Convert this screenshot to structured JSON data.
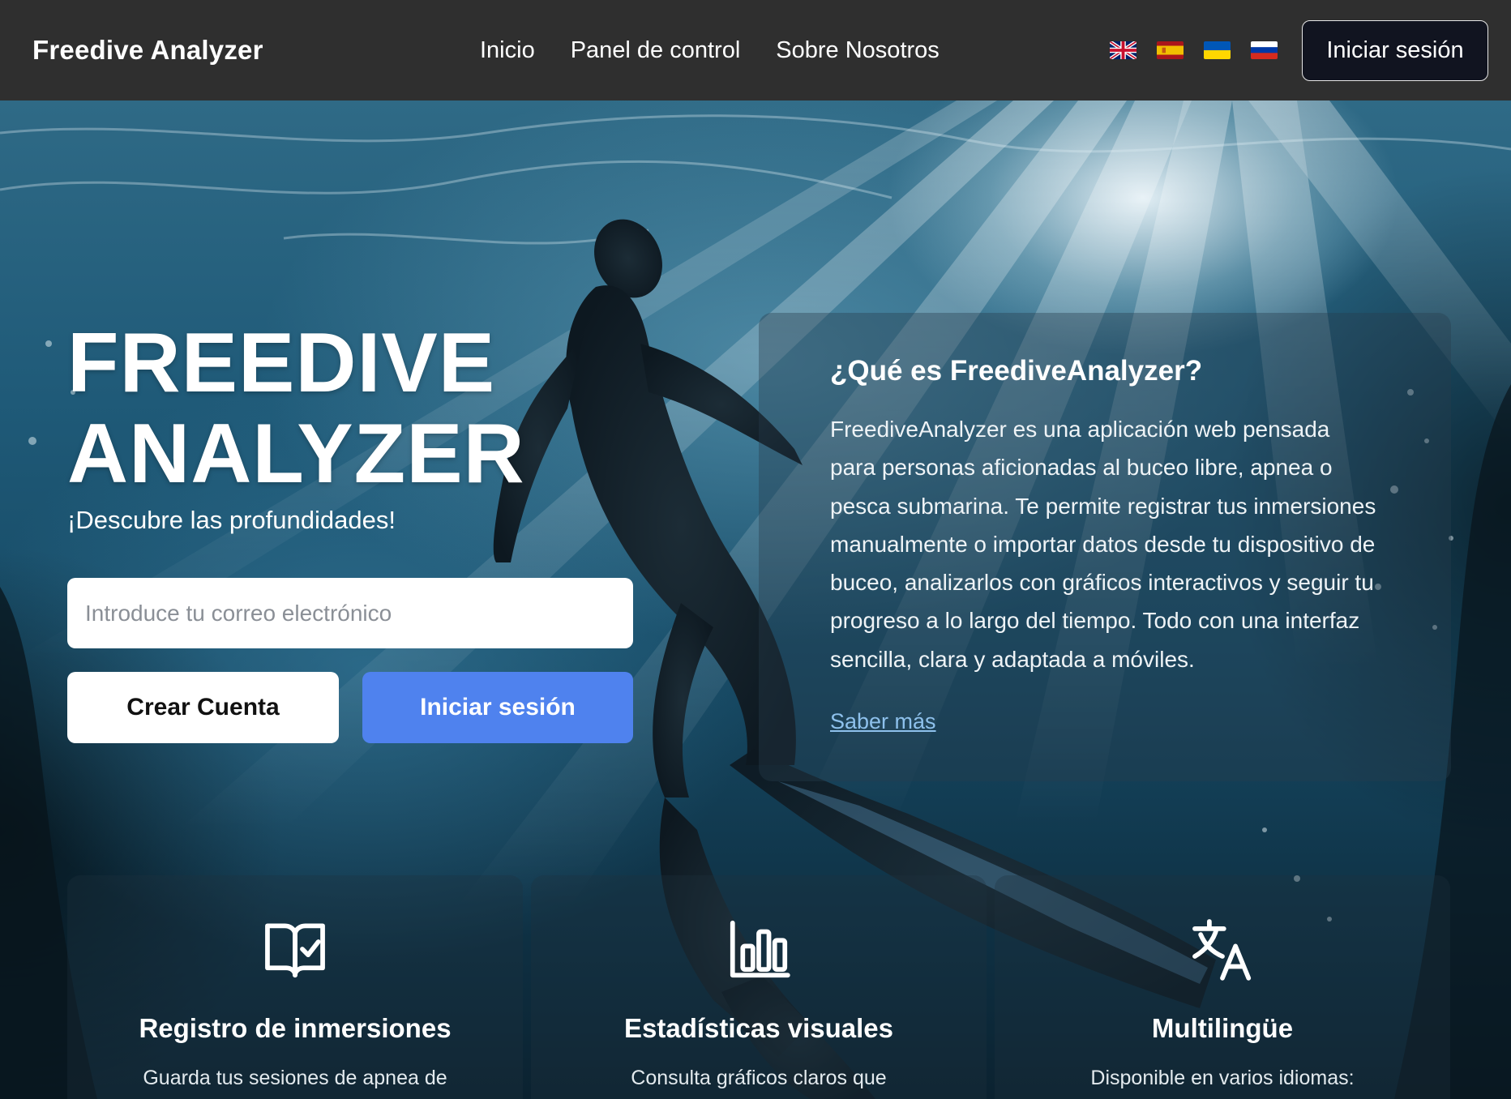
{
  "nav": {
    "brand": "Freedive Analyzer",
    "links": [
      "Inicio",
      "Panel de control",
      "Sobre Nosotros"
    ],
    "languages": [
      "flag-uk-icon",
      "flag-es-icon",
      "flag-ua-icon",
      "flag-ru-icon"
    ],
    "login_label": "Iniciar sesión"
  },
  "hero": {
    "title_line1": "FREEDIVE",
    "title_line2": "ANALYZER",
    "tagline": "¡Descubre las profundidades!",
    "email_placeholder": "Introduce tu correo electrónico",
    "create_account_label": "Crear Cuenta",
    "login_label": "Iniciar sesión"
  },
  "info": {
    "title": "¿Qué es FreediveAnalyzer?",
    "text": "FreediveAnalyzer es una aplicación web pensada para personas aficionadas al buceo libre, apnea o pesca submarina. Te permite registrar tus inmersiones manualmente o importar datos desde tu dispositivo de buceo, analizarlos con gráficos interactivos y seguir tu progreso a lo largo del tiempo. Todo con una interfaz sencilla, clara y adaptada a móviles.",
    "link_label": "Saber más"
  },
  "features": [
    {
      "icon": "book-check-icon",
      "title": "Registro de inmersiones",
      "desc": "Guarda tus sesiones de apnea de"
    },
    {
      "icon": "bar-chart-icon",
      "title": "Estadísticas visuales",
      "desc": "Consulta gráficos claros que"
    },
    {
      "icon": "translate-icon",
      "title": "Multilingüe",
      "desc": "Disponible en varios idiomas:"
    }
  ],
  "colors": {
    "navbar_bg": "#2f2f2f",
    "primary_button": "#4f82ee",
    "link": "#8ec1ec"
  }
}
